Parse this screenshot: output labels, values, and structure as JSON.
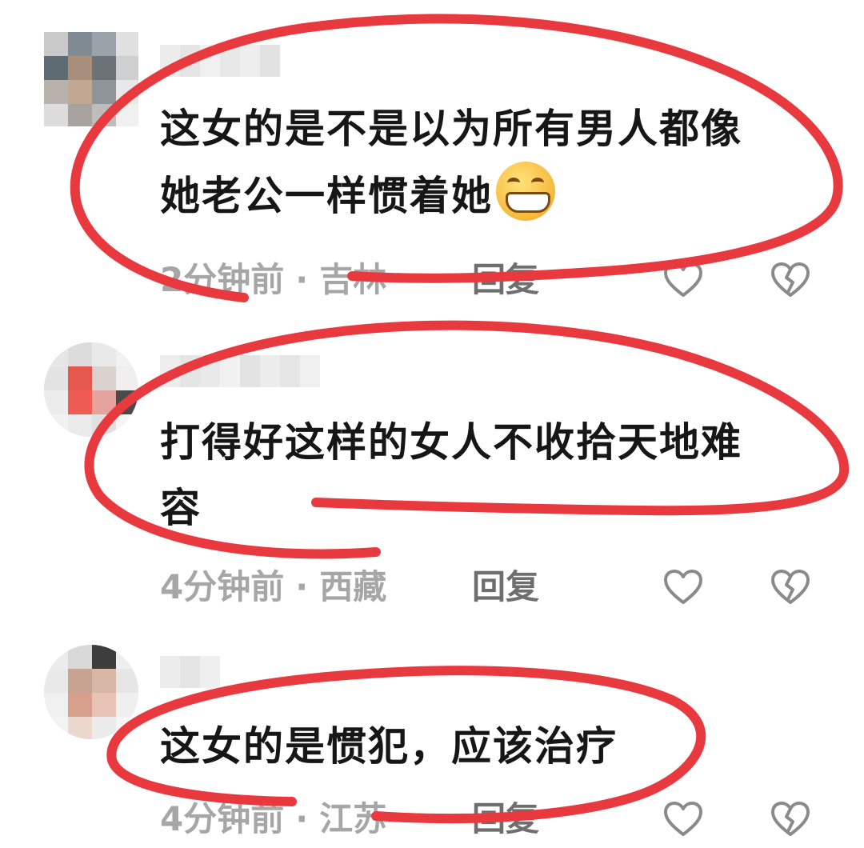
{
  "comments": [
    {
      "text_line1": "这女的是不是以为所有男人都像",
      "text_line2": "她老公一样惯着她",
      "emoji": "grinning-face-emoji",
      "time": "2分钟前",
      "location": "吉林",
      "reply_label": "回复"
    },
    {
      "text_line1": "打得好这样的女人不收拾天地难",
      "text_line2": "容",
      "time": "4分钟前",
      "location": "西藏",
      "reply_label": "回复"
    },
    {
      "text_line1": "这女的是惯犯，应该治疗",
      "time": "4分钟前",
      "location": "江苏",
      "reply_label": "回复"
    }
  ],
  "meta_separator": "·",
  "icons": {
    "like": "heart-outline-icon",
    "dislike": "broken-heart-icon"
  },
  "colors": {
    "text": "#161616",
    "meta": "#a6a6a6",
    "reply": "#6e6e6e",
    "annotation": "#e8393f"
  }
}
